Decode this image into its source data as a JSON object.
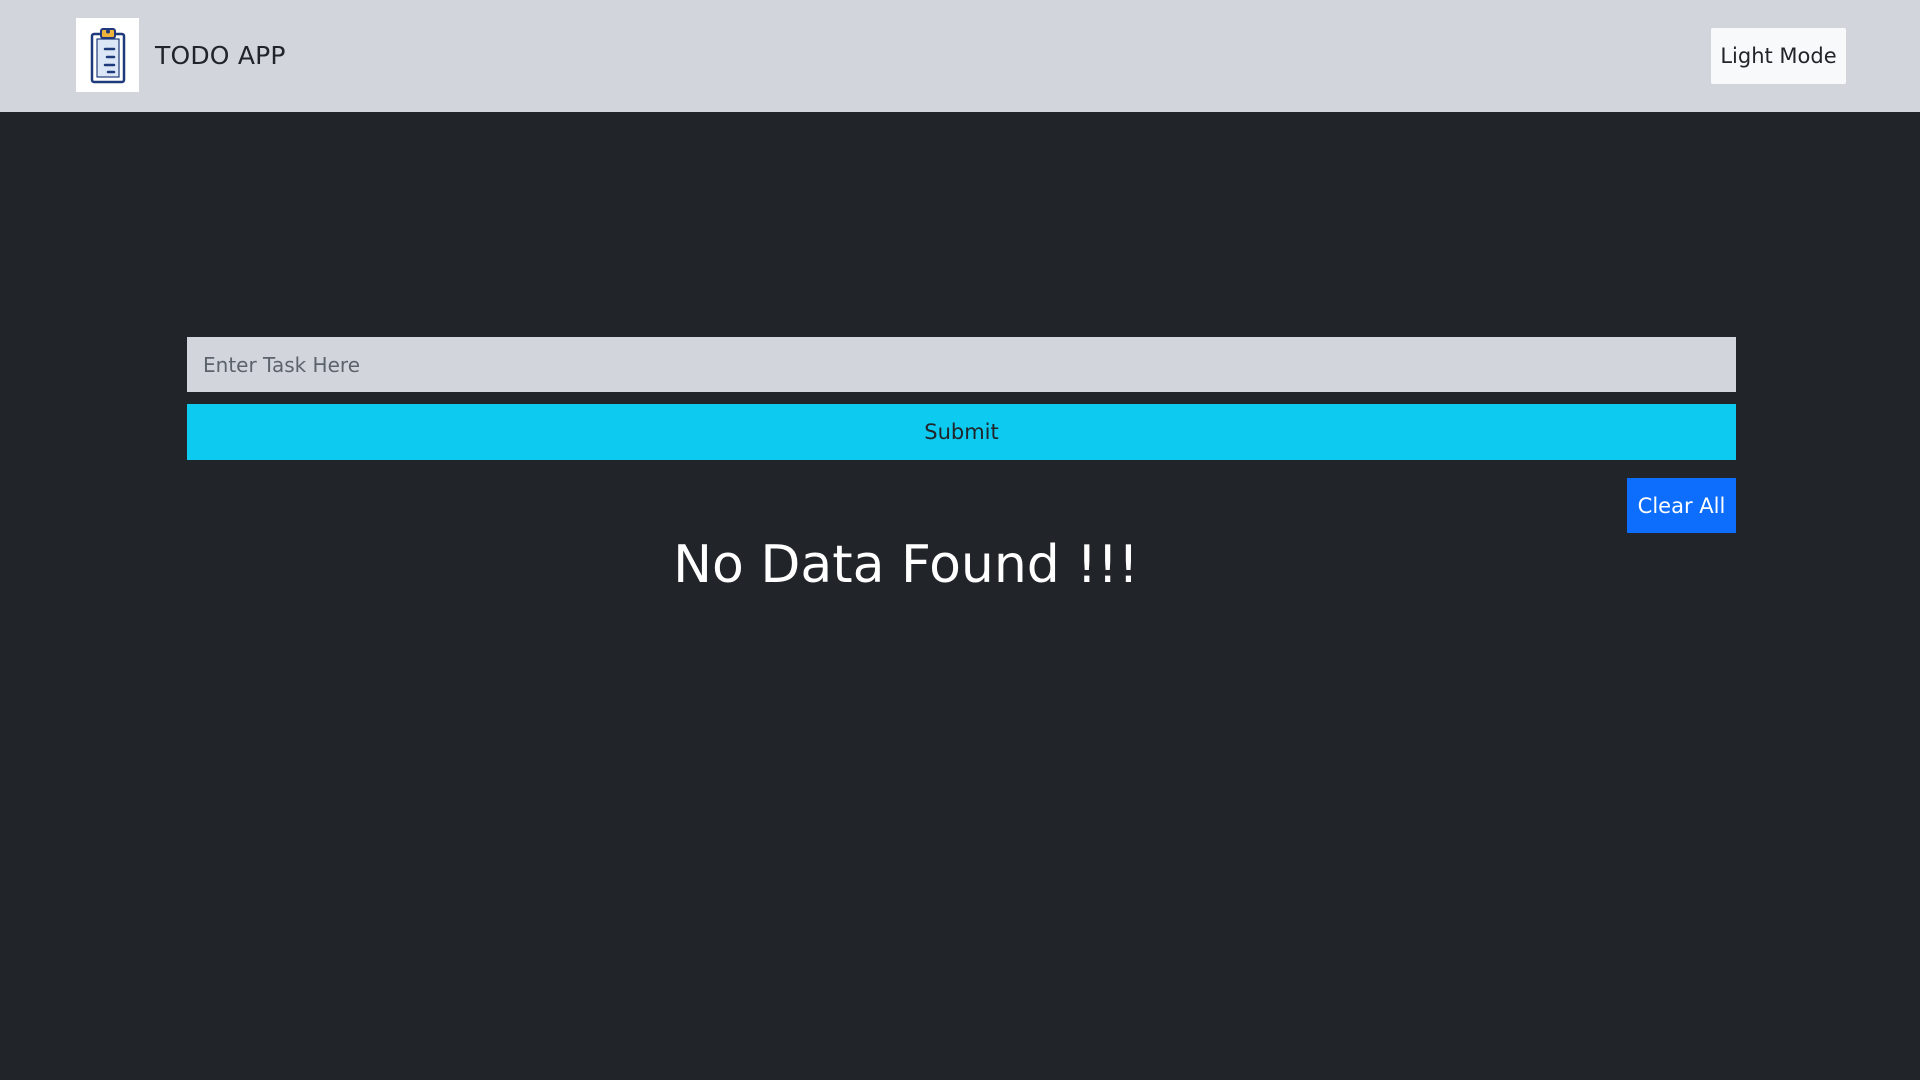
{
  "navbar": {
    "title": "TODO APP",
    "logo_icon": "clipboard-list-icon",
    "mode_button_label": "Light Mode"
  },
  "form": {
    "task_placeholder": "Enter Task Here",
    "task_value": "",
    "submit_label": "Submit"
  },
  "list": {
    "clear_all_label": "Clear All",
    "empty_message": "No Data Found !!!"
  },
  "colors": {
    "page_background": "#212529",
    "navbar_background": "#d2d6dc",
    "submit_button": "#0dcaf0",
    "clear_button": "#0d6efd",
    "mode_button": "#f8f9fa"
  }
}
